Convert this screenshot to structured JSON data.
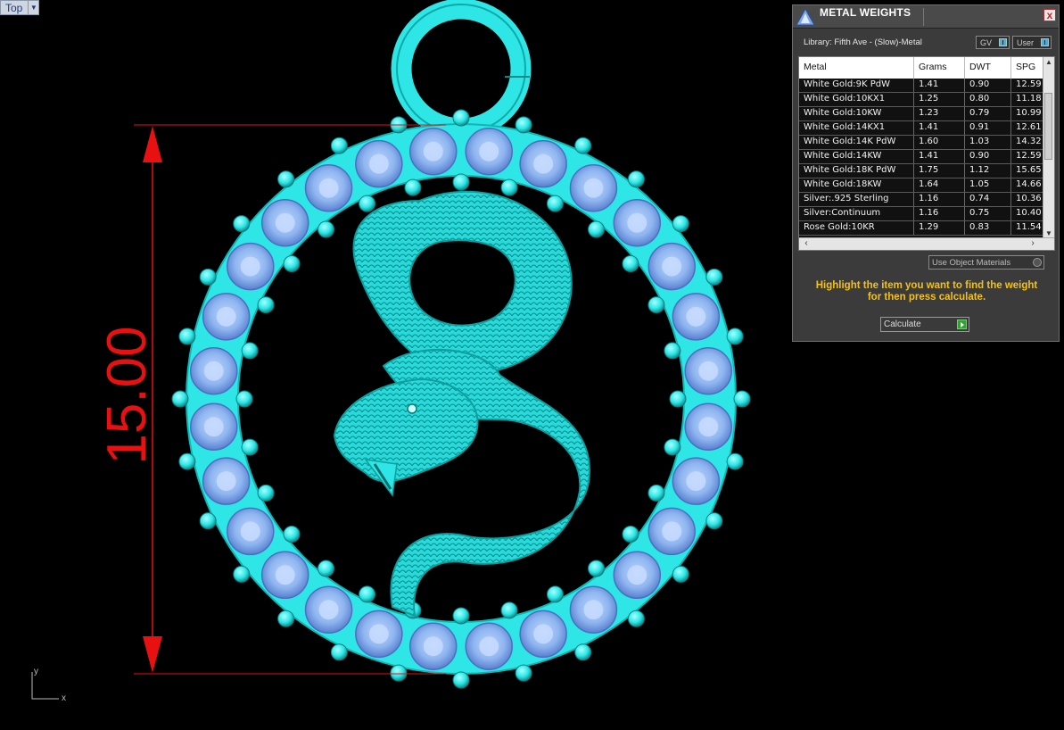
{
  "viewport": {
    "name": "Top",
    "dimension_value": "15.00",
    "axis_x": "x",
    "axis_y": "y"
  },
  "panel": {
    "title": "METAL WEIGHTS",
    "close": "x",
    "library": "Library: Fifth Ave - (Slow)-Metal",
    "toggle_gv": "GV",
    "toggle_user": "User",
    "columns": [
      "Metal",
      "Grams",
      "DWT",
      "SPG"
    ],
    "rows": [
      [
        "White Gold:9K PdW",
        "1.41",
        "0.90",
        "12.59"
      ],
      [
        "White Gold:10KX1",
        "1.25",
        "0.80",
        "11.18"
      ],
      [
        "White Gold:10KW",
        "1.23",
        "0.79",
        "10.99"
      ],
      [
        "White Gold:14KX1",
        "1.41",
        "0.91",
        "12.61"
      ],
      [
        "White Gold:14K PdW",
        "1.60",
        "1.03",
        "14.32"
      ],
      [
        "White Gold:14KW",
        "1.41",
        "0.90",
        "12.59"
      ],
      [
        "White Gold:18K PdW",
        "1.75",
        "1.12",
        "15.65"
      ],
      [
        "White Gold:18KW",
        "1.64",
        "1.05",
        "14.66"
      ],
      [
        "Silver:.925 Sterling",
        "1.16",
        "0.74",
        "10.36"
      ],
      [
        "Silver:Continuum",
        "1.16",
        "0.75",
        "10.40"
      ],
      [
        "Rose Gold:10KR",
        "1.29",
        "0.83",
        "11.54"
      ]
    ],
    "use_object_materials": "Use Object Materials",
    "hint_line1": "Highlight the item you want to find the weight",
    "hint_line2": "for then press calculate.",
    "calculate": "Calculate"
  },
  "colors": {
    "model": "#2ee6e6",
    "dimension": "#e81010",
    "gem": "#8fb6f0",
    "hint": "#f2c11b"
  }
}
